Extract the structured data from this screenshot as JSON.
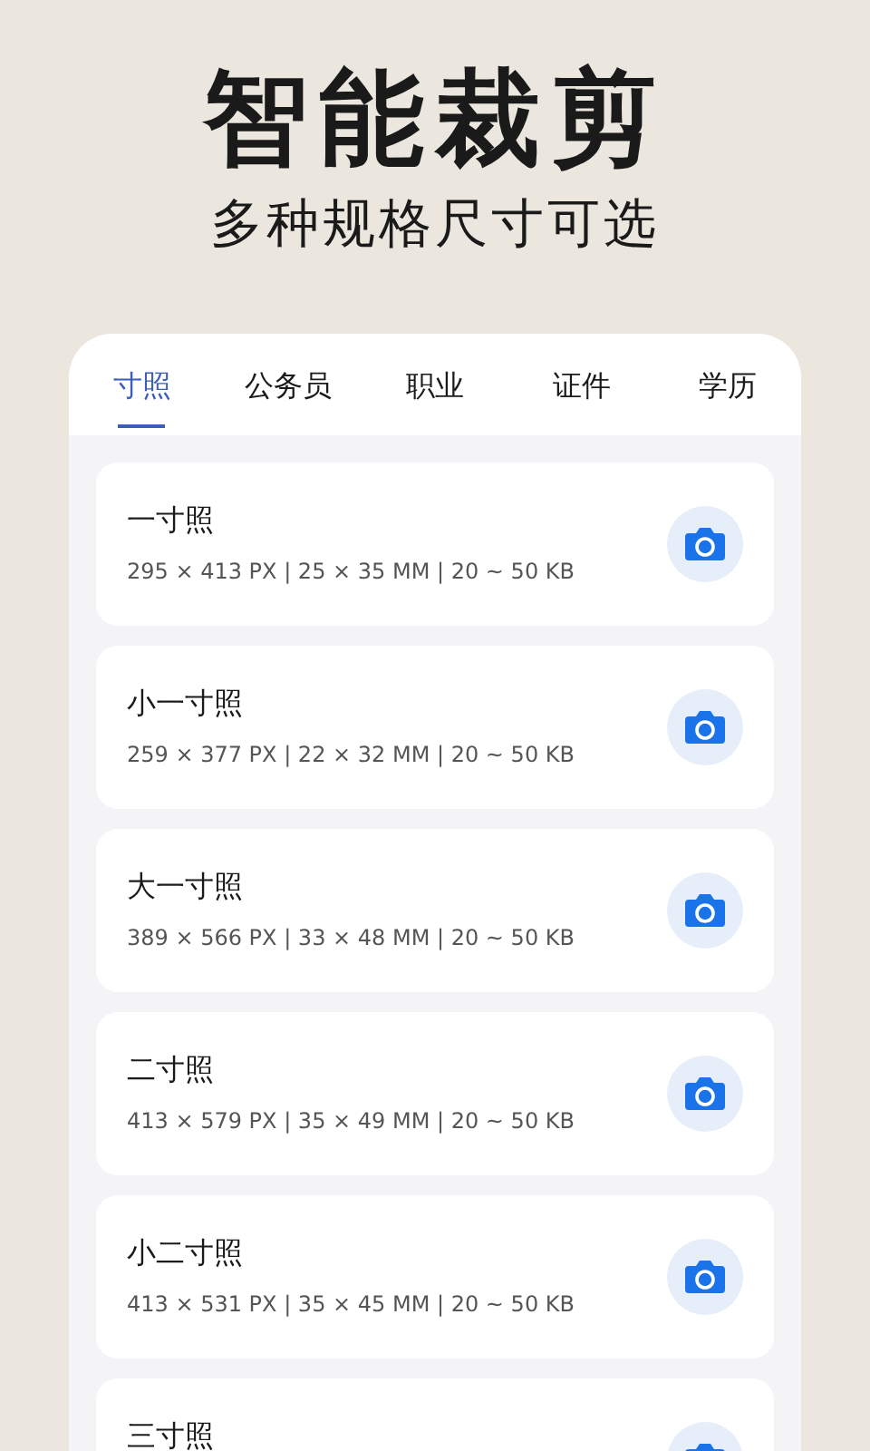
{
  "headline": "智能裁剪",
  "subtitle": "多种规格尺寸可选",
  "tabs": [
    {
      "label": "寸照",
      "selected": true
    },
    {
      "label": "公务员",
      "selected": false
    },
    {
      "label": "职业",
      "selected": false
    },
    {
      "label": "证件",
      "selected": false
    },
    {
      "label": "学历",
      "selected": false
    }
  ],
  "items": [
    {
      "title": "一寸照",
      "spec": "295 × 413 PX | 25 × 35 MM | 20 ~ 50 KB"
    },
    {
      "title": "小一寸照",
      "spec": "259 × 377 PX | 22 × 32 MM | 20 ~ 50 KB"
    },
    {
      "title": "大一寸照",
      "spec": "389 × 566 PX | 33 × 48 MM | 20 ~ 50 KB"
    },
    {
      "title": "二寸照",
      "spec": "413 × 579 PX | 35 × 49 MM | 20 ~ 50 KB"
    },
    {
      "title": "小二寸照",
      "spec": "413 × 531 PX | 35 × 45 MM | 20 ~ 50 KB"
    },
    {
      "title": "三寸照"
    }
  ]
}
